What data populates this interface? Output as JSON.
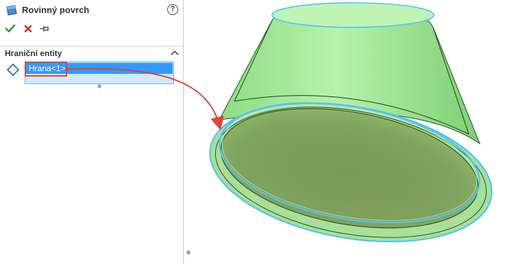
{
  "feature_panel": {
    "title": "Rovinný povrch",
    "icon": "planar-surface-icon",
    "help_glyph": "?",
    "actions": [
      {
        "name": "ok",
        "icon": "check-icon",
        "color": "#2e9a2e"
      },
      {
        "name": "cancel",
        "icon": "close-icon",
        "color": "#d8261c"
      },
      {
        "name": "pin",
        "icon": "pushpin-icon",
        "color": "#555555"
      }
    ]
  },
  "boundary_section": {
    "title": "Hraniční entity",
    "icon": "edge-selection-icon",
    "selected_items": [
      "Hrana<1>"
    ]
  },
  "colors": {
    "selection_highlight": "#3399ff",
    "selection_box_bg": "#d3e8f8",
    "callout": "#e0433a",
    "edge_highlight": "#4fc3f7",
    "model_fill": "#9be88f"
  },
  "viewport": {
    "model": "truncated-cone-body"
  }
}
